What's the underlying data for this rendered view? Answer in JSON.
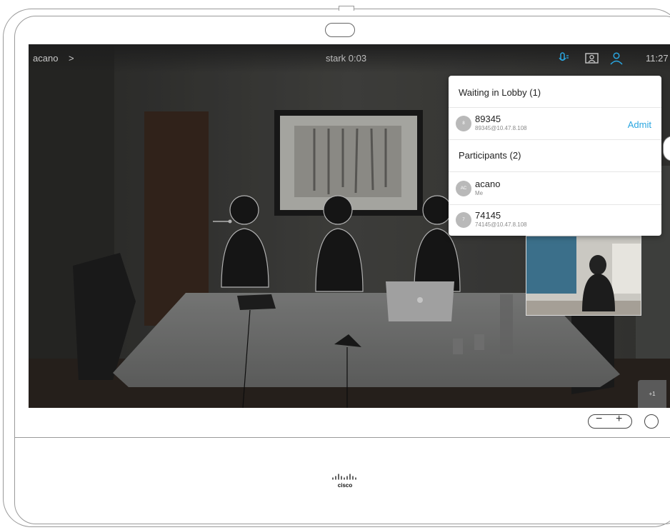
{
  "topbar": {
    "call_id": "acano",
    "call_id_chevron": ">",
    "call_title": "stark  0:03",
    "time": "11:27",
    "icons": [
      "mic-icon",
      "layout-icon",
      "participants-icon"
    ]
  },
  "lobby_panel": {
    "waiting_heading": "Waiting in Lobby (1)",
    "waiting": [
      {
        "avatar": "8",
        "name": "89345",
        "address": "89345@10.47.8.108",
        "action": "Admit"
      }
    ],
    "participants_heading": "Participants (2)",
    "participants": [
      {
        "avatar": "AC",
        "name": "acano",
        "address": "Me"
      },
      {
        "avatar": "7",
        "name": "74145",
        "address": "74145@10.47.8.108"
      }
    ]
  },
  "self_view": {
    "badge": "+1"
  },
  "device": {
    "volume_minus": "−",
    "volume_plus": "+",
    "logo": "cisco"
  },
  "colors": {
    "accent": "#2aa6e0",
    "mic_icon": "#2aa6e0",
    "participants_icon": "#2aa6e0"
  }
}
